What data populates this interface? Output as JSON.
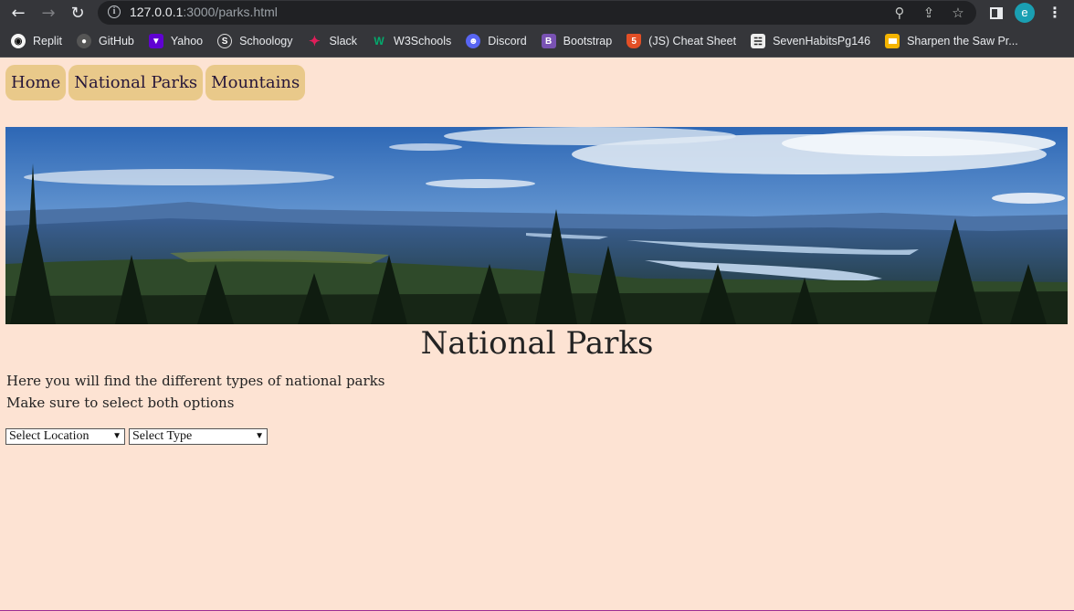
{
  "browser": {
    "url_host": "127.0.0.1",
    "url_rest": ":3000/parks.html",
    "profile_initial": "e",
    "bookmarks": [
      {
        "label": "Replit",
        "icon": "replit-icon"
      },
      {
        "label": "GitHub",
        "icon": "github-icon"
      },
      {
        "label": "Yahoo",
        "icon": "yahoo-icon"
      },
      {
        "label": "Schoology",
        "icon": "schoology-icon"
      },
      {
        "label": "Slack",
        "icon": "slack-icon"
      },
      {
        "label": "W3Schools",
        "icon": "w3schools-icon"
      },
      {
        "label": "Discord",
        "icon": "discord-icon"
      },
      {
        "label": "Bootstrap",
        "icon": "bootstrap-icon"
      },
      {
        "label": "(JS) Cheat Sheet",
        "icon": "html5-icon"
      },
      {
        "label": "SevenHabitsPg146",
        "icon": "library-icon"
      },
      {
        "label": "Sharpen the Saw Pr...",
        "icon": "slides-icon"
      }
    ]
  },
  "nav": {
    "home": "Home",
    "parks": "National Parks",
    "mountains": "Mountains"
  },
  "main": {
    "title": "National Parks",
    "line1": "Here you will find the different types of national parks",
    "line2": "Make sure to select both options",
    "location_select": "Select Location",
    "type_select": "Select Type"
  },
  "colors": {
    "page_bg": "#fde3d3",
    "nav_button_bg": "#e9c98a",
    "nav_text": "#26163a",
    "chrome_bg": "#35363a"
  }
}
